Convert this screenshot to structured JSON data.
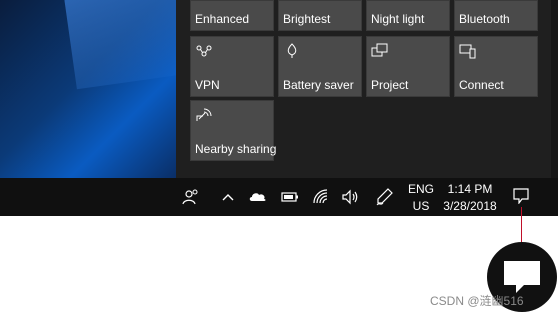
{
  "quick_actions": {
    "row1": [
      "Enhanced",
      "Brightest",
      "Night light",
      "Bluetooth"
    ],
    "row2": [
      "VPN",
      "Battery saver",
      "Project",
      "Connect"
    ],
    "row3": [
      "Nearby sharing"
    ]
  },
  "taskbar": {
    "language": "ENG",
    "region": "US",
    "time": "1:14 PM",
    "date": "3/28/2018"
  },
  "watermark": "CSDN @涟幽516",
  "colors": {
    "tile": "#4a4a4a",
    "action_center_bg": "#1f1f1f",
    "taskbar_bg": "#101010",
    "callout_line": "#c0102a"
  },
  "icons": [
    "people-icon",
    "chevron-up-icon",
    "onedrive-cloud-icon",
    "battery-icon",
    "wifi-icon",
    "volume-icon",
    "pen-icon",
    "notification-icon",
    "vpn-icon",
    "battery-saver-icon",
    "project-icon",
    "connect-icon",
    "nearby-sharing-icon"
  ]
}
